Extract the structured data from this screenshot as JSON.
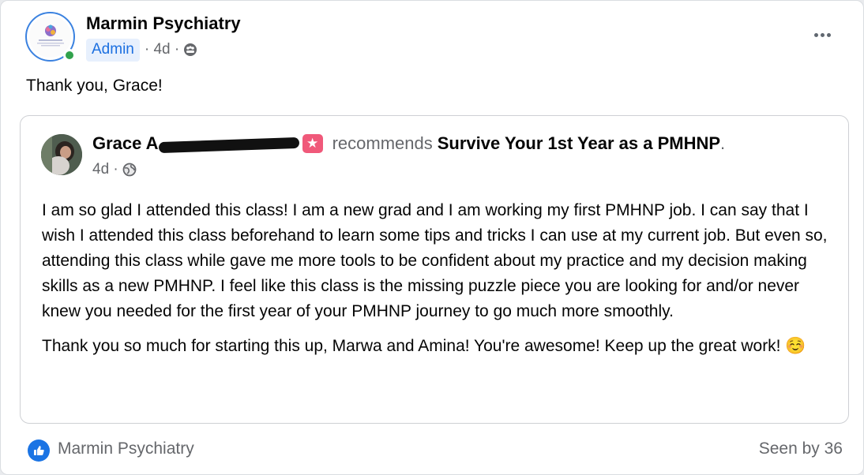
{
  "post": {
    "author": "Marmin Psychiatry",
    "badge": "Admin",
    "time": "· 4d ·",
    "audience_icon": "group-audience-icon",
    "text": "Thank you, Grace!"
  },
  "recommendation": {
    "reviewer_name": "Grace A",
    "recommends_word": "recommends",
    "target": "Survive Your 1st Year as a PMHNP",
    "target_suffix": ".",
    "time": "4d ·",
    "audience_icon": "globe-icon",
    "paragraph_1": "I am so glad I attended this class! I am a new grad and I am working my first PMHNP job. I can say that I wish I attended this class beforehand to learn some tips and tricks I can use at my current job. But even so, attending this class while gave me more tools to be confident about my practice and my decision making skills as a new PMHNP. I feel like this class is the missing puzzle piece you are looking for and/or never knew you needed for the first year of your PMHNP journey to go much more smoothly.",
    "paragraph_2": "Thank you so much for starting this up, Marwa and Amina! You're awesome! Keep up the great work! ☺️"
  },
  "footer": {
    "reaction_icon": "like-icon",
    "reactor": "Marmin Psychiatry",
    "seen_by": "Seen by 36"
  },
  "colors": {
    "accent_blue": "#1b74e4",
    "admin_badge_bg": "#e7f0fd",
    "online_green": "#31a24c",
    "recommend_pink": "#f0597a",
    "secondary_text": "#65676b"
  }
}
